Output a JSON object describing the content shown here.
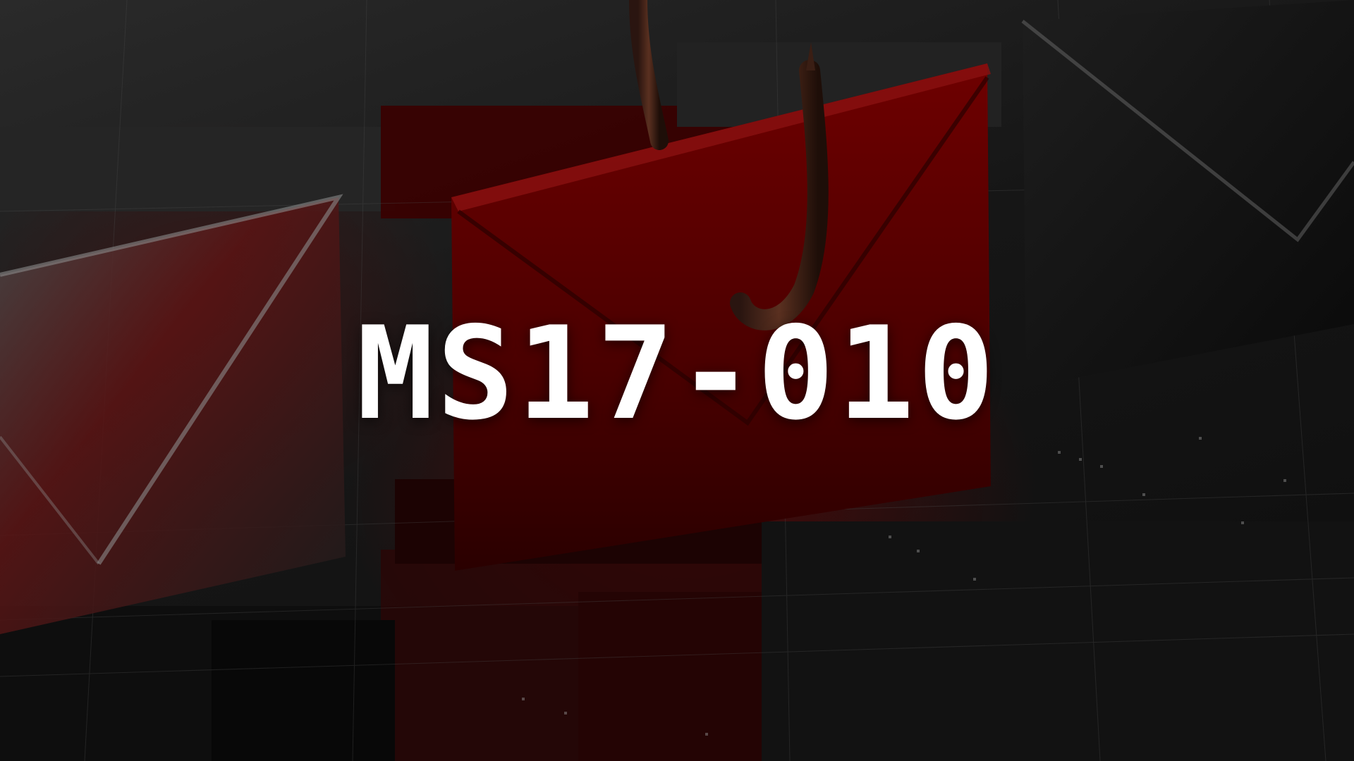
{
  "headline": "MS17-010",
  "colors": {
    "text": "#ffffff",
    "accent_red": "#8b0000",
    "dark_red": "#3a0000",
    "metal_dark": "#1a1a1a"
  },
  "scene_elements": {
    "left_envelope": "envelope-icon",
    "center_envelope": "envelope-icon",
    "right_envelope": "envelope-icon",
    "hook": "fishing-hook-icon"
  }
}
